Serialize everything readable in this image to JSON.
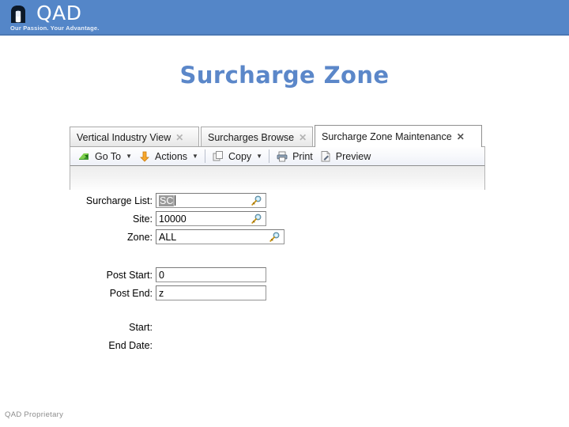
{
  "header": {
    "logo_word": "QAD",
    "logo_tagline": "Our Passion. Your Advantage.",
    "logo_icon": "qad-arch-logo-icon",
    "bar_color": "#5486c8"
  },
  "page_title": "Surcharge Zone",
  "title_color": "#5b87c9",
  "app": {
    "tabs": [
      {
        "label": "Vertical Industry View",
        "close": "✕",
        "active": false
      },
      {
        "label": "Surcharges Browse",
        "close": "✕",
        "active": false
      },
      {
        "label": "Surcharge Zone Maintenance",
        "close": "✕",
        "active": true
      }
    ],
    "toolbar": [
      {
        "label": "Go To",
        "icon": "go-to-icon",
        "caret": "▼"
      },
      {
        "label": "Actions",
        "icon": "actions-icon",
        "caret": "▼"
      },
      {
        "label": "Copy",
        "icon": "copy-icon",
        "caret": "▼"
      },
      {
        "label": "Print",
        "icon": "print-icon",
        "caret": ""
      },
      {
        "label": "Preview",
        "icon": "preview-icon",
        "caret": ""
      }
    ]
  },
  "form": {
    "fields": [
      {
        "label": "Surcharge List:",
        "value": "SC",
        "selected": true,
        "lookup": "lookup-key-icon"
      },
      {
        "label": "Site:",
        "value": "10000",
        "selected": false,
        "lookup": "lookup-key-icon"
      },
      {
        "label": "Zone:",
        "value": "ALL",
        "selected": false,
        "lookup": "lookup-key-icon"
      },
      {
        "label": "Post Start:",
        "value": "0",
        "selected": false,
        "lookup": ""
      },
      {
        "label": "Post End:",
        "value": "z",
        "selected": false,
        "lookup": ""
      }
    ],
    "static_labels": [
      {
        "label": "Start:"
      },
      {
        "label": "End Date:"
      }
    ]
  },
  "footer": "QAD Proprietary"
}
